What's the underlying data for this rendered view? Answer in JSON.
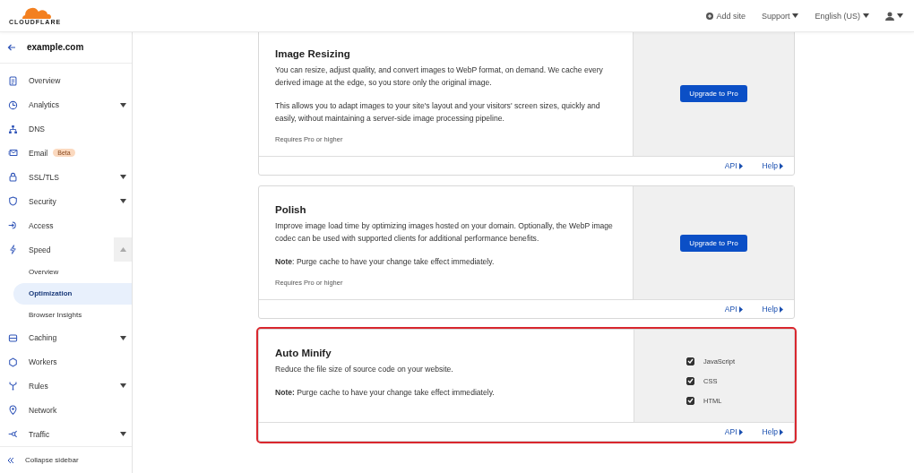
{
  "header": {
    "logo_text": "CLOUDFLARE",
    "nav": [
      {
        "label": "Add site",
        "kind": "add"
      },
      {
        "label": "Support",
        "kind": "menu"
      },
      {
        "label": "English (US)",
        "kind": "menu"
      },
      {
        "kind": "user"
      }
    ]
  },
  "sidebar": {
    "domain": "example.com",
    "items": [
      {
        "label": "Overview"
      },
      {
        "label": "Analytics",
        "expanded": false
      },
      {
        "label": "DNS"
      },
      {
        "label": "Email",
        "badge": "Beta"
      },
      {
        "label": "SSL/TLS",
        "expanded": false
      },
      {
        "label": "Security",
        "expanded": false
      },
      {
        "label": "Access"
      },
      {
        "label": "Speed",
        "expanded": true,
        "children": [
          {
            "label": "Overview",
            "selected": false
          },
          {
            "label": "Optimization",
            "selected": true
          },
          {
            "label": "Browser Insights",
            "selected": false
          }
        ]
      },
      {
        "label": "Caching",
        "expanded": false
      },
      {
        "label": "Workers"
      },
      {
        "label": "Rules",
        "expanded": false
      },
      {
        "label": "Network"
      },
      {
        "label": "Traffic",
        "expanded": false
      }
    ],
    "collapse": "Collapse sidebar"
  },
  "cards": [
    {
      "title": "Image Resizing",
      "kind": "upgrade",
      "highlighted": false,
      "paragraphs": [
        "You can resize, adjust quality, and convert images to WebP format, on demand. We cache every derived image at the edge, so you store only the original image.",
        "This allows you to adapt images to your site's layout and your visitors' screen sizes, quickly and easily, without maintaining a server-side image processing pipeline."
      ],
      "requirement": "Requires Pro or higher",
      "button": "Upgrade to Pro",
      "links": [
        "API",
        "Help"
      ]
    },
    {
      "title": "Polish",
      "kind": "upgrade",
      "highlighted": false,
      "paragraphs": [
        "Improve image load time by optimizing images hosted on your domain. Optionally, the WebP image codec can be used with supported clients for additional performance benefits.",
        "**Note**: Purge cache to have your change take effect immediately."
      ],
      "requirement": "Requires Pro or higher",
      "button": "Upgrade to Pro",
      "links": [
        "API",
        "Help"
      ]
    },
    {
      "title": "Auto Minify",
      "kind": "toggles",
      "highlighted": true,
      "paragraphs": [
        "Reduce the file size of source code on your website.",
        "**Note:** Purge cache to have your change take effect immediately."
      ],
      "options": [
        {
          "label": "JavaScript",
          "checked": true
        },
        {
          "label": "CSS",
          "checked": true
        },
        {
          "label": "HTML",
          "checked": true
        }
      ],
      "links": [
        "API",
        "Help"
      ]
    }
  ]
}
